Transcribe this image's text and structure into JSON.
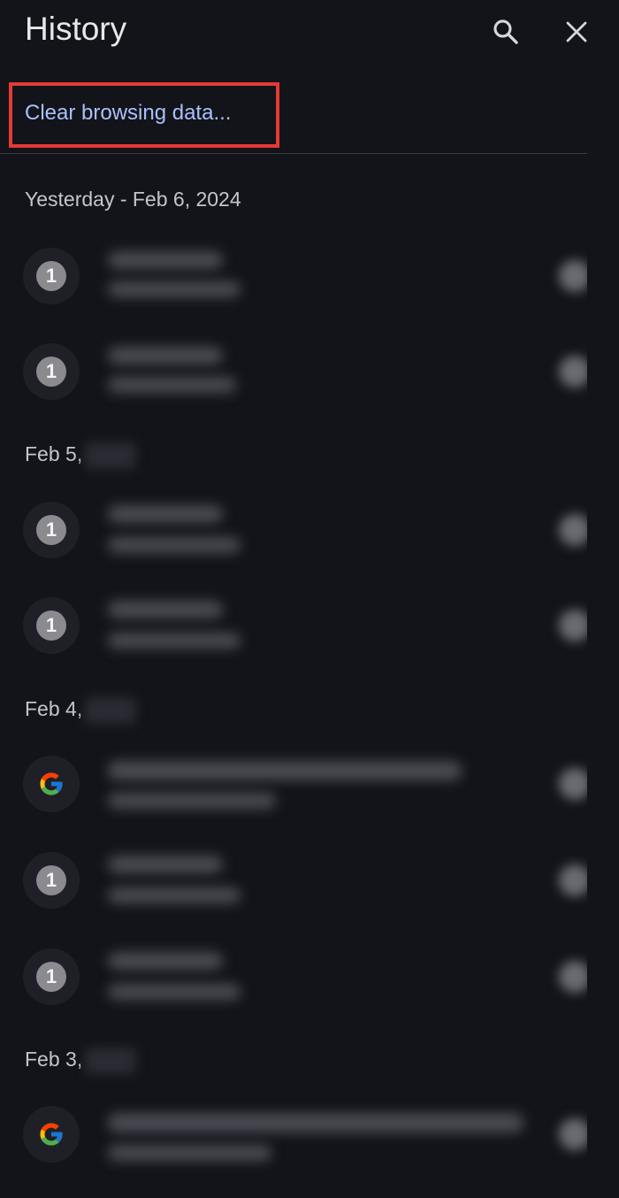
{
  "header": {
    "title": "History",
    "search_icon": "search-icon",
    "close_icon": "close-icon"
  },
  "actions": {
    "clear_label": "Clear browsing data..."
  },
  "sections": [
    {
      "header": "Yesterday - Feb 6, 2024",
      "items": [
        {
          "icon": "number-1-favicon"
        },
        {
          "icon": "number-1-favicon"
        }
      ]
    },
    {
      "header": "Feb 5,",
      "items": [
        {
          "icon": "number-1-favicon"
        },
        {
          "icon": "number-1-favicon"
        }
      ]
    },
    {
      "header": "Feb 4,",
      "items": [
        {
          "icon": "google-icon"
        },
        {
          "icon": "number-1-favicon"
        },
        {
          "icon": "number-1-favicon"
        }
      ]
    },
    {
      "header": "Feb 3,",
      "items": [
        {
          "icon": "google-icon"
        }
      ]
    }
  ],
  "favicon_badge": "1",
  "colors": {
    "background": "#131419",
    "link": "#a8c0ff",
    "highlight": "#e53935"
  }
}
